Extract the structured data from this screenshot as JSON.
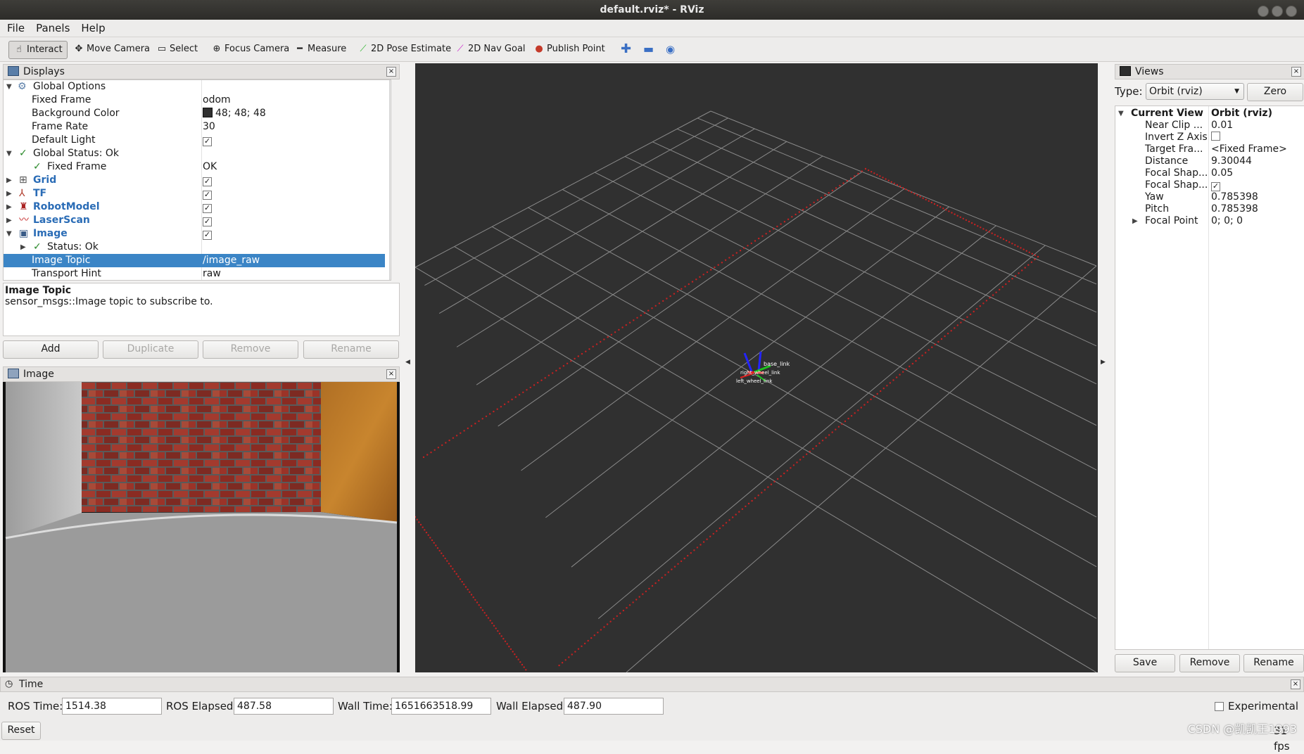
{
  "window": {
    "title": "default.rviz* - RViz"
  },
  "menu": [
    "File",
    "Panels",
    "Help"
  ],
  "toolbar": [
    {
      "label": "Interact",
      "icon": "hand-icon",
      "active": true
    },
    {
      "label": "Move Camera",
      "icon": "move-camera-icon"
    },
    {
      "label": "Select",
      "icon": "select-icon"
    },
    {
      "label": "Focus Camera",
      "icon": "focus-camera-icon"
    },
    {
      "label": "Measure",
      "icon": "measure-icon"
    },
    {
      "label": "2D Pose Estimate",
      "icon": "pose-estimate-icon"
    },
    {
      "label": "2D Nav Goal",
      "icon": "nav-goal-icon"
    },
    {
      "label": "Publish Point",
      "icon": "publish-point-icon"
    }
  ],
  "displays": {
    "title": "Displays",
    "rows": [
      {
        "label": "Global Options",
        "value": "",
        "icon": "gear-icon"
      },
      {
        "label": "Fixed Frame",
        "value": "odom"
      },
      {
        "label": "Background Color",
        "value": "48; 48; 48"
      },
      {
        "label": "Frame Rate",
        "value": "30"
      },
      {
        "label": "Default Light",
        "value": "✓"
      },
      {
        "label": "Global Status: Ok",
        "value": ""
      },
      {
        "label": "Fixed Frame",
        "value": "OK"
      },
      {
        "label": "Grid",
        "value": "✓"
      },
      {
        "label": "TF",
        "value": "✓"
      },
      {
        "label": "RobotModel",
        "value": "✓"
      },
      {
        "label": "LaserScan",
        "value": "✓"
      },
      {
        "label": "Image",
        "value": "✓"
      },
      {
        "label": "Status: Ok",
        "value": ""
      },
      {
        "label": "Image Topic",
        "value": "/image_raw"
      },
      {
        "label": "Transport Hint",
        "value": "raw"
      }
    ],
    "description_title": "Image Topic",
    "description_text": "sensor_msgs::Image topic to subscribe to.",
    "buttons": {
      "add": "Add",
      "duplicate": "Duplicate",
      "remove": "Remove",
      "rename": "Rename"
    }
  },
  "image_panel": {
    "title": "Image"
  },
  "views": {
    "title": "Views",
    "type_label": "Type:",
    "type_value": "Orbit (rviz)",
    "zero": "Zero",
    "rows": [
      {
        "label": "Current View",
        "value": "Orbit (rviz)"
      },
      {
        "label": "Near Clip ...",
        "value": "0.01"
      },
      {
        "label": "Invert Z Axis",
        "value": ""
      },
      {
        "label": "Target Fra...",
        "value": "<Fixed Frame>"
      },
      {
        "label": "Distance",
        "value": "9.30044"
      },
      {
        "label": "Focal Shap...",
        "value": "0.05"
      },
      {
        "label": "Focal Shap...",
        "value": "✓"
      },
      {
        "label": "Yaw",
        "value": "0.785398"
      },
      {
        "label": "Pitch",
        "value": "0.785398"
      },
      {
        "label": "Focal Point",
        "value": "0; 0; 0"
      }
    ],
    "buttons": {
      "save": "Save",
      "remove": "Remove",
      "rename": "Rename"
    }
  },
  "time": {
    "title": "Time",
    "ros_time_label": "ROS Time:",
    "ros_time": "1514.38",
    "ros_elapsed_label": "ROS Elapsed:",
    "ros_elapsed": "487.58",
    "wall_time_label": "Wall Time:",
    "wall_time": "1651663518.99",
    "wall_elapsed_label": "Wall Elapsed:",
    "wall_elapsed": "487.90",
    "experimental": "Experimental",
    "reset": "Reset",
    "fps": "31 fps"
  },
  "viewport": {
    "frame_labels": [
      "base_link",
      "right_wheel_link",
      "left_wheel_link"
    ],
    "background": "#303030",
    "laser_color": "#c42121"
  },
  "watermark": "CSDN @凯凯王1993"
}
